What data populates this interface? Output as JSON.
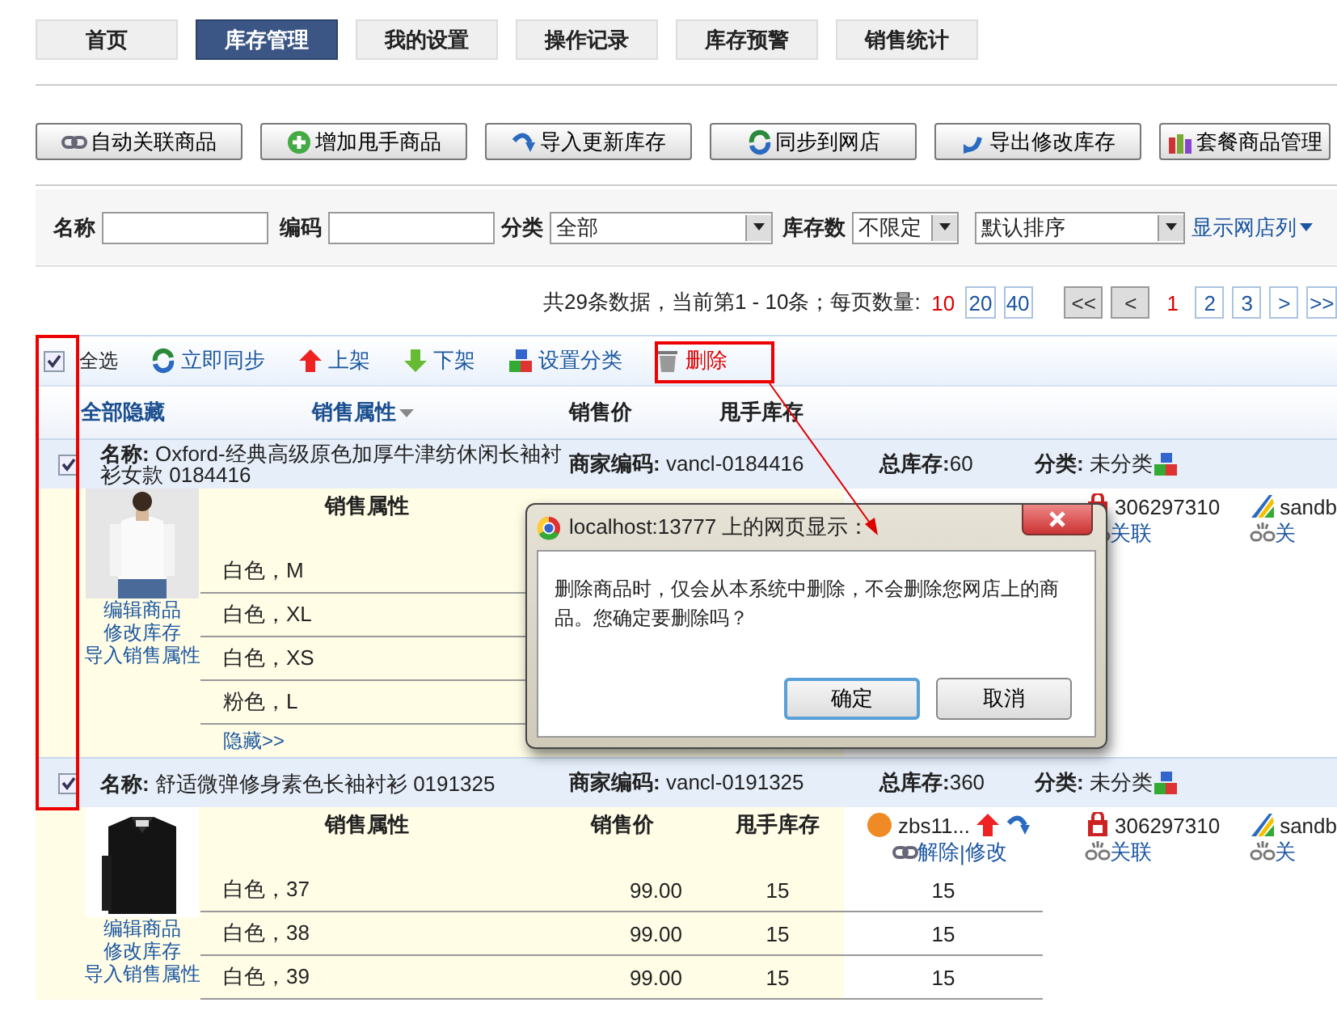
{
  "nav_tabs": [
    {
      "label": "首页",
      "selected": false
    },
    {
      "label": "库存管理",
      "selected": true
    },
    {
      "label": "我的设置",
      "selected": false
    },
    {
      "label": "操作记录",
      "selected": false
    },
    {
      "label": "库存预警",
      "selected": false
    },
    {
      "label": "销售统计",
      "selected": false
    }
  ],
  "toolbar": [
    {
      "label": "自动关联商品"
    },
    {
      "label": "增加甩手商品"
    },
    {
      "label": "导入更新库存"
    },
    {
      "label": "同步到网店"
    },
    {
      "label": "导出修改库存"
    },
    {
      "label": "套餐商品管理"
    }
  ],
  "filters": {
    "name_label": "名称",
    "code_label": "编码",
    "category_label": "分类",
    "category_value": "全部",
    "stock_label": "库存数",
    "stock_value": "不限定",
    "sort_value": "默认排序",
    "shop_columns_link": "显示网店列"
  },
  "pagination": {
    "summary": "共29条数据，当前第1 - 10条；每页数量:",
    "page_sizes": [
      {
        "label": "10",
        "selected": true
      },
      {
        "label": "20",
        "selected": false
      },
      {
        "label": "40",
        "selected": false
      }
    ],
    "pages": [
      {
        "label": "<<",
        "selected": false,
        "disabled": true
      },
      {
        "label": "<",
        "selected": false,
        "disabled": true
      },
      {
        "label": "1",
        "selected": true,
        "disabled": false
      },
      {
        "label": "2",
        "selected": false,
        "disabled": false
      },
      {
        "label": "3",
        "selected": false,
        "disabled": false
      },
      {
        "label": ">",
        "selected": false,
        "disabled": false
      },
      {
        "label": ">>",
        "selected": false,
        "disabled": false
      }
    ]
  },
  "actions": {
    "select_all": {
      "label": "全选",
      "checked": true
    },
    "buttons": [
      {
        "label": "立即同步",
        "kind": "normal"
      },
      {
        "label": "上架",
        "kind": "normal"
      },
      {
        "label": "下架",
        "kind": "normal"
      },
      {
        "label": "设置分类",
        "kind": "normal"
      },
      {
        "label": "删除",
        "kind": "danger"
      }
    ]
  },
  "list_header": {
    "hide_all": "全部隐藏",
    "attributes": "销售属性",
    "price": "销售价",
    "stock": "甩手库存"
  },
  "products": [
    {
      "checked": true,
      "name_label": "名称:",
      "name": "Oxford-经典高级原色加厚牛津纺休闲长袖衬衫女款 0184416",
      "code_label": "商家编码:",
      "code": "vancl-0184416",
      "total_label": "总库存:",
      "total": "60",
      "category_label": "分类:",
      "category": "未分类",
      "picture": {
        "kind": "picture"
      },
      "links": [
        "编辑商品",
        "修改库存",
        "导入销售属性"
      ],
      "sub_header": [
        "销售属性"
      ],
      "variants": [
        {
          "attr": "白色，M"
        },
        {
          "attr": "白色，XL"
        },
        {
          "attr": "白色，XS"
        },
        {
          "attr": "粉色，L"
        }
      ],
      "hide_link": "隐藏>>",
      "shops": [
        {
          "kind": "bag",
          "name": "306297310",
          "links": [
            "关联"
          ]
        },
        {
          "kind": "stripes",
          "name": "sandb",
          "links": [
            "关"
          ]
        }
      ]
    },
    {
      "checked": true,
      "name_label": "名称:",
      "name": "舒适微弹修身素色长袖衬衫 0191325",
      "code_label": "商家编码:",
      "code": "vancl-0191325",
      "total_label": "总库存:",
      "total": "360",
      "category_label": "分类:",
      "category": "未分类",
      "picture": {
        "kind": "picture"
      },
      "links": [
        "编辑商品",
        "修改库存",
        "导入销售属性"
      ],
      "sub_header": [
        "销售属性",
        "销售价",
        "甩手库存"
      ],
      "variants": [
        {
          "attr": "白色，37",
          "price": "99.00",
          "stock": "15"
        },
        {
          "attr": "白色，38",
          "price": "99.00",
          "stock": "15"
        },
        {
          "attr": "白色，39",
          "price": "99.00",
          "stock": "15"
        }
      ],
      "shops": [
        {
          "kind": "taobao",
          "name": "zbs11...",
          "links": [
            "解除",
            "修改"
          ],
          "separator": "|",
          "stocks": [
            "15",
            "15",
            "15"
          ]
        },
        {
          "kind": "bag",
          "name": "306297310",
          "links": [
            "关联"
          ]
        },
        {
          "kind": "stripes",
          "name": "sandb",
          "links": [
            "关"
          ]
        }
      ]
    }
  ],
  "dialog": {
    "title": "localhost:13777 上的网页显示：",
    "message": "删除商品时，仅会从本系统中删除，不会删除您网店上的商品。您确定要删除吗？",
    "buttons": [
      {
        "label": "确定",
        "focused": true
      },
      {
        "label": "取消",
        "focused": false
      }
    ]
  }
}
